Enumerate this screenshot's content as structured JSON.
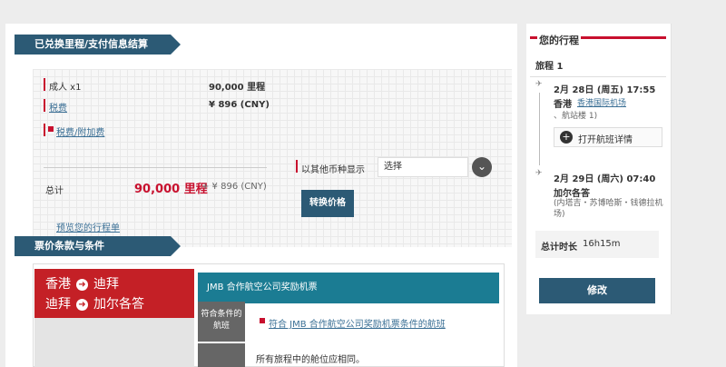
{
  "payment_section": {
    "title": "已兑换里程/支付信息结算",
    "adult_label": "成人 x1",
    "adult_miles": "90,000 里程",
    "tax_label": "税费",
    "tax_value": "¥ 896 (CNY)",
    "surcharge_label": "税费/附加费",
    "total_label": "总计",
    "total_miles": "90,000 里程",
    "total_plus": "+ ¥ 896 (CNY)",
    "itinerary_link": "预览您的行程单",
    "currency_label": "以其他币种显示",
    "currency_select": "选择",
    "convert_button": "转换价格"
  },
  "fare_section": {
    "title": "票价条款与条件",
    "route_line1_from": "香港",
    "route_line1_to": "迪拜",
    "route_line2_from": "迪拜",
    "route_line2_to": "加尔各答",
    "fare_header": "JMB 合作航空公司奖励机票",
    "row1_label": "符合条件的航班",
    "row1_link": "符合 JMB 合作航空公司奖励机票条件的航班",
    "row2_text": "所有旅程中的舱位应相同。"
  },
  "itinerary": {
    "title": "您的行程",
    "trip_label": "旅程 1",
    "dep_datetime": "2月 28日 (周五) 17:55",
    "dep_city": "香港",
    "dep_airport": "香港国际机场",
    "dep_terminal": "、航站楼 1)",
    "flight_details": "打开航班详情",
    "arr_datetime": "2月 29日 (周六) 07:40",
    "arr_city": "加尔各答",
    "arr_airport": "(内塔吉・苏博哈斯・钱德拉机场)",
    "duration_label": "总计时长",
    "duration_value": "16h15m",
    "modify_button": "修改"
  },
  "colors": {
    "brand_red": "#c42026",
    "ribbon_blue": "#2c5a75",
    "teal": "#1b7c93"
  }
}
